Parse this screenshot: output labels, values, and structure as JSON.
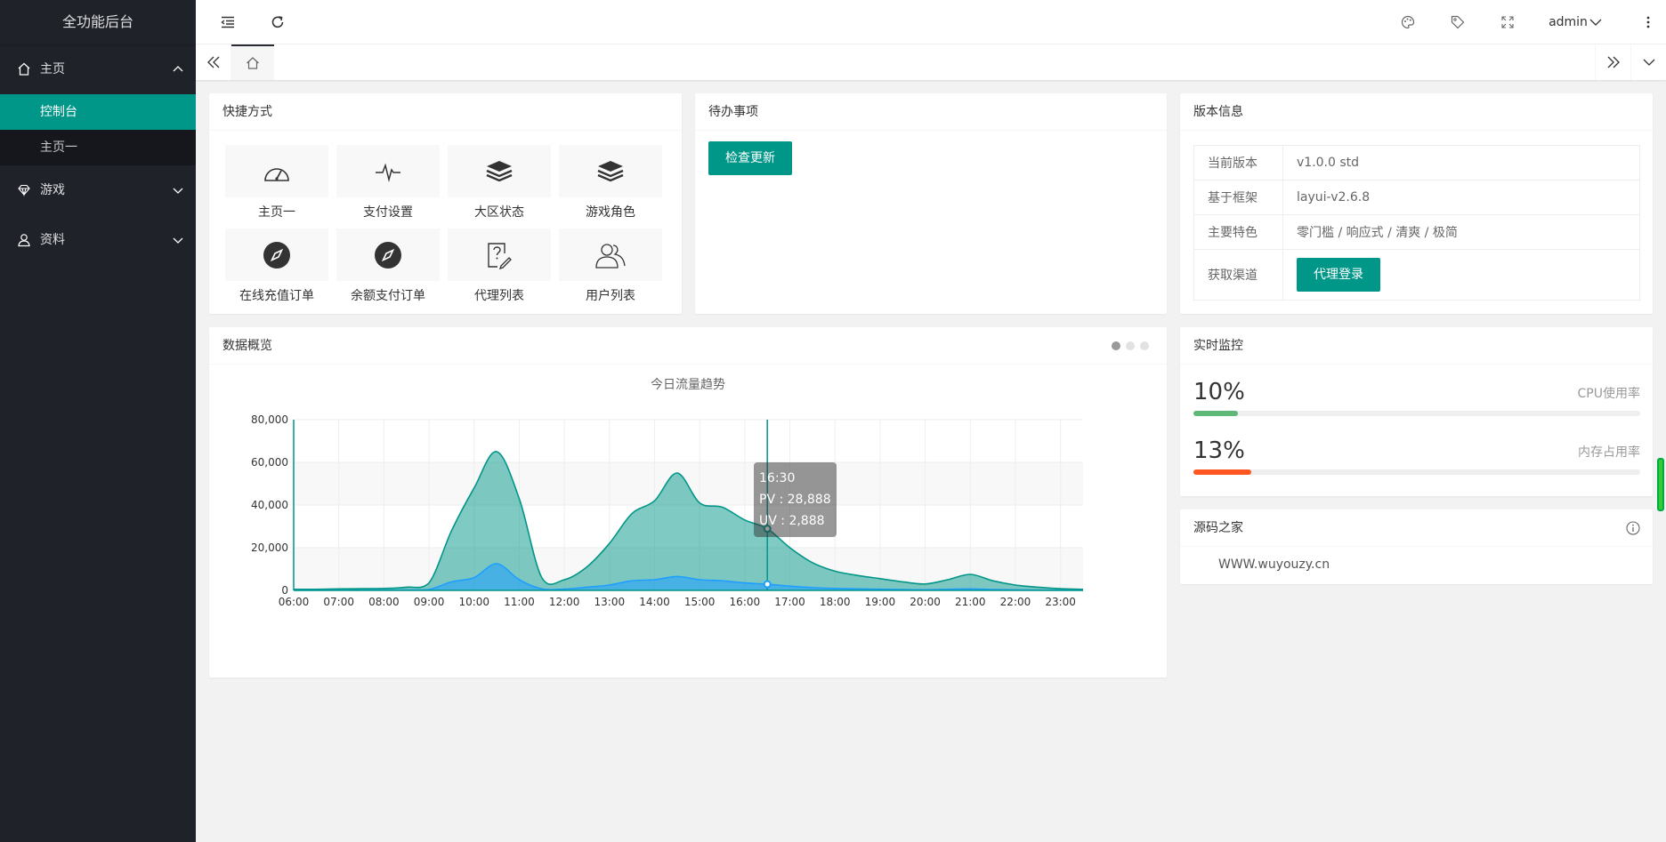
{
  "app": {
    "title": "全功能后台"
  },
  "sidebar": {
    "items": [
      {
        "label": "主页",
        "icon": "home-icon",
        "expanded": true,
        "children": [
          {
            "label": "控制台",
            "active": true
          },
          {
            "label": "主页一",
            "active": false
          }
        ]
      },
      {
        "label": "游戏",
        "icon": "diamond-icon",
        "expanded": false
      },
      {
        "label": "资料",
        "icon": "user-icon",
        "expanded": false
      }
    ]
  },
  "header": {
    "user": "admin"
  },
  "shortcuts": {
    "title": "快捷方式",
    "items": [
      {
        "label": "主页一",
        "icon": "dashboard-gauge-icon"
      },
      {
        "label": "支付设置",
        "icon": "pulse-icon"
      },
      {
        "label": "大区状态",
        "icon": "layers-icon"
      },
      {
        "label": "游戏角色",
        "icon": "layers-icon"
      },
      {
        "label": "在线充值订单",
        "icon": "compass-icon"
      },
      {
        "label": "余额支付订单",
        "icon": "compass-icon"
      },
      {
        "label": "代理列表",
        "icon": "help-edit-icon"
      },
      {
        "label": "用户列表",
        "icon": "users-icon"
      }
    ]
  },
  "todo": {
    "title": "待办事项",
    "button": "检查更新"
  },
  "version": {
    "title": "版本信息",
    "rows": [
      {
        "key": "当前版本",
        "value": "v1.0.0 std"
      },
      {
        "key": "基于框架",
        "value": "layui-v2.6.8"
      },
      {
        "key": "主要特色",
        "value": "零门槛 / 响应式 / 清爽 / 极简"
      },
      {
        "key": "获取渠道",
        "button": "代理登录"
      }
    ]
  },
  "overview": {
    "title": "数据概览"
  },
  "monitor": {
    "title": "实时监控",
    "items": [
      {
        "value": "10%",
        "label": "CPU使用率",
        "percent": 10,
        "color": "#5FB878"
      },
      {
        "value": "13%",
        "label": "内存占用率",
        "percent": 13,
        "color": "#FF5722"
      }
    ]
  },
  "source": {
    "title": "源码之家",
    "url": "WWW.wuyouzy.cn"
  },
  "chart_data": {
    "type": "area",
    "title": "今日流量趋势",
    "categories": [
      "06:00",
      "06:30",
      "07:00",
      "07:30",
      "08:00",
      "08:30",
      "09:00",
      "09:30",
      "10:00",
      "10:30",
      "11:00",
      "11:30",
      "12:00",
      "12:30",
      "13:00",
      "13:30",
      "14:00",
      "14:30",
      "15:00",
      "15:30",
      "16:00",
      "16:30",
      "17:00",
      "17:30",
      "18:00",
      "18:30",
      "19:00",
      "19:30",
      "20:00",
      "20:30",
      "21:00",
      "21:30",
      "22:00",
      "22:30",
      "23:00",
      "23:30"
    ],
    "x_tick_labels": [
      "06:00",
      "07:00",
      "08:00",
      "09:00",
      "10:00",
      "11:00",
      "12:00",
      "13:00",
      "14:00",
      "15:00",
      "16:00",
      "17:00",
      "18:00",
      "19:00",
      "20:00",
      "21:00",
      "22:00",
      "23:00"
    ],
    "series": [
      {
        "name": "PV",
        "color": "#009688",
        "values": [
          500,
          500,
          700,
          800,
          900,
          1500,
          3500,
          28000,
          48000,
          65000,
          43000,
          6000,
          5000,
          11000,
          22000,
          36000,
          42000,
          55000,
          41000,
          39000,
          33000,
          28888,
          20000,
          13000,
          9000,
          7000,
          5500,
          4000,
          3000,
          5000,
          7500,
          4500,
          2500,
          1500,
          800,
          500
        ]
      },
      {
        "name": "UV",
        "color": "#1E9FFF",
        "values": [
          50,
          50,
          100,
          100,
          150,
          200,
          400,
          4000,
          6000,
          12500,
          5000,
          700,
          600,
          1500,
          2500,
          4500,
          5000,
          6500,
          5000,
          4500,
          3500,
          2888,
          2000,
          1300,
          900,
          700,
          550,
          400,
          300,
          500,
          700,
          400,
          250,
          150,
          80,
          50
        ]
      }
    ],
    "ylim": [
      0,
      80000
    ],
    "y_ticks": [
      "0",
      "20,000",
      "40,000",
      "60,000",
      "80,000"
    ],
    "grid": true,
    "tooltip": {
      "title": "16:30",
      "lines": [
        "PV : 28,888",
        "UV : 2,888"
      ]
    }
  }
}
